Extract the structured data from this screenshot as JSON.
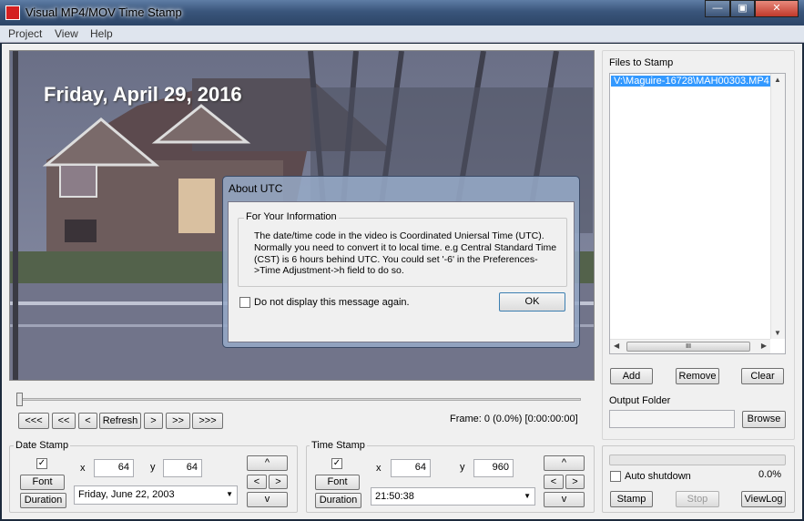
{
  "window": {
    "title": "Visual MP4/MOV Time Stamp",
    "min": "—",
    "max": "▣",
    "close": "✕"
  },
  "menu": [
    "Project",
    "View",
    "Help"
  ],
  "video": {
    "stamp_text": "Friday, April 29, 2016"
  },
  "dialog": {
    "title": "About UTC",
    "group_label": "For Your Information",
    "message": "The date/time code in the video is Coordinated Uniersal Time (UTC). Normally you need to convert it to local time. e.g Central Standard Time (CST) is 6 hours behind UTC. You could set '-6' in the Preferences->Time Adjustment->h field to do so.",
    "checkbox_label": "Do not display this message again.",
    "ok": "OK"
  },
  "transport": {
    "buttons": [
      "<<<",
      "<<",
      "<",
      "Refresh",
      ">",
      ">>",
      ">>>"
    ],
    "frame_text": "Frame: 0 (0.0%) [0:00:00:00]",
    "slider_position": 0
  },
  "files": {
    "label": "Files to Stamp",
    "items": [
      "V:\\Maguire-16728\\MAH00303.MP4"
    ],
    "add": "Add",
    "remove": "Remove",
    "clear": "Clear",
    "scroll_grip": "III"
  },
  "output": {
    "label": "Output Folder",
    "value": "",
    "browse": "Browse"
  },
  "date_stamp": {
    "label": "Date Stamp",
    "font": "Font",
    "duration": "Duration",
    "x_label": "x",
    "x": "64",
    "y_label": "y",
    "y": "64",
    "format": "Friday, June 22, 2003",
    "up": "^",
    "left": "<",
    "right": ">",
    "down": "v",
    "checked": true
  },
  "time_stamp": {
    "label": "Time Stamp",
    "font": "Font",
    "duration": "Duration",
    "x_label": "x",
    "x": "64",
    "y_label": "y",
    "y": "960",
    "format": "21:50:38",
    "up": "^",
    "left": "<",
    "right": ">",
    "down": "v",
    "checked": true
  },
  "progress": {
    "value": "0.0%",
    "fraction": 0.0,
    "auto_shutdown": "Auto shutdown",
    "stamp": "Stamp",
    "stop": "Stop",
    "viewlog": "ViewLog"
  },
  "colors": {
    "selection": "#3399ff",
    "title_bg": "#3a557b"
  }
}
